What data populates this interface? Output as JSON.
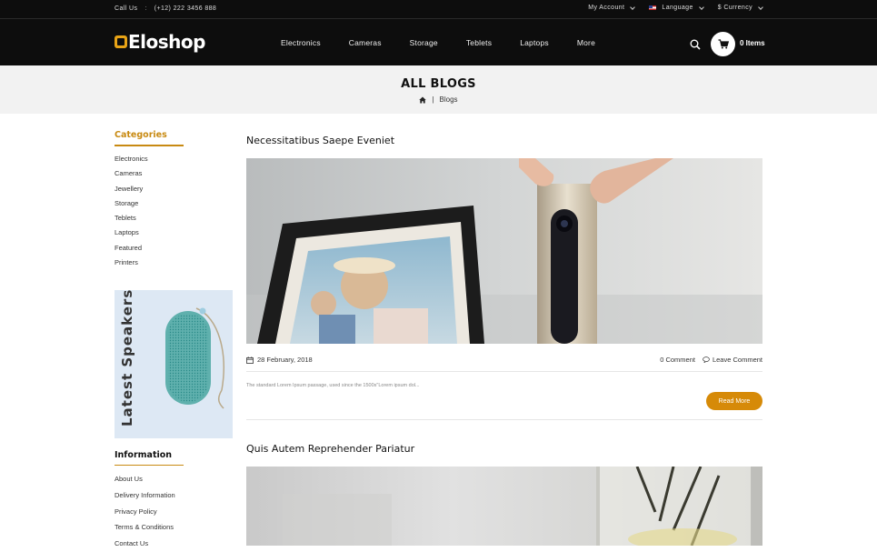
{
  "topbar": {
    "call_label": "Call Us",
    "call_sep": ":",
    "phone": "(+12) 222 3456 888",
    "account": "My Account",
    "language": "Language",
    "currency": "$ Currency"
  },
  "header": {
    "logo": "Eloshop",
    "nav": [
      "Electronics",
      "Cameras",
      "Storage",
      "Teblets",
      "Laptops",
      "More"
    ],
    "cart_count": "0 Items"
  },
  "banner": {
    "title": "ALL BLOGS",
    "crumb_sep": "|",
    "crumb": "Blogs"
  },
  "sidebar": {
    "categories_title": "Categories",
    "categories": [
      "Electronics",
      "Cameras",
      "Jewellery",
      "Storage",
      "Teblets",
      "Laptops",
      "Featured",
      "Printers"
    ],
    "promo_text": "Latest Speakers",
    "info_title": "Information",
    "info_links": [
      "About Us",
      "Delivery Information",
      "Privacy Policy",
      "Terms & Conditions",
      "Contact Us"
    ]
  },
  "posts": [
    {
      "title": "Necessitatibus Saepe Eveniet",
      "date": "28 February, 2018",
      "comments": "0 Comment",
      "leave_comment": "Leave Comment",
      "excerpt": "The standard Lorem Ipsum passage, used since the 1500s\"Lorem ipsum dol...",
      "read_more": "Read More"
    },
    {
      "title": "Quis Autem Reprehender Pariatur"
    }
  ],
  "colors": {
    "accent": "#d68a08",
    "header_bg": "#0d0d0d",
    "banner_bg": "#f2f2f2"
  }
}
